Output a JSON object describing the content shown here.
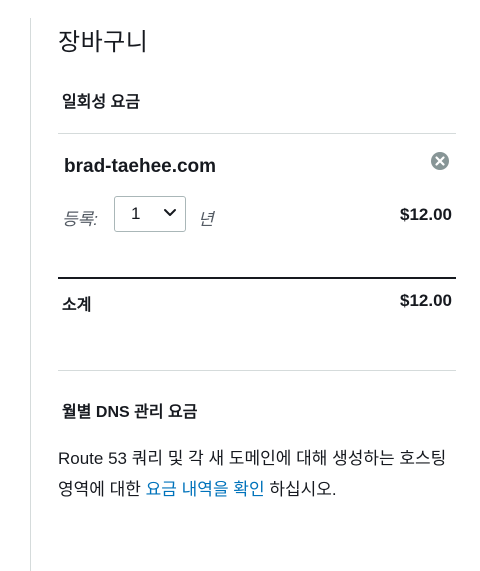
{
  "cart": {
    "title": "장바구니",
    "one_time_section_title": "일회성 요금",
    "item": {
      "domain": "brad-taehee.com",
      "registration_label": "등록:",
      "years_value": "1",
      "years_label": "년",
      "price": "$12.00",
      "remove_icon": "remove-circle-icon"
    },
    "subtotal": {
      "label": "소계",
      "value": "$12.00"
    },
    "dns_section_title": "월별 DNS 관리 요금",
    "dns_description_before": "Route 53 쿼리 및 각 새 도메인에 대해 생성하는 호스팅 영역에 대한 ",
    "dns_description_link": "요금 내역을 확인",
    "dns_description_after": " 하십시오."
  },
  "colors": {
    "link": "#0073bb",
    "text": "#16191f",
    "divider": "#d5dbdb"
  }
}
